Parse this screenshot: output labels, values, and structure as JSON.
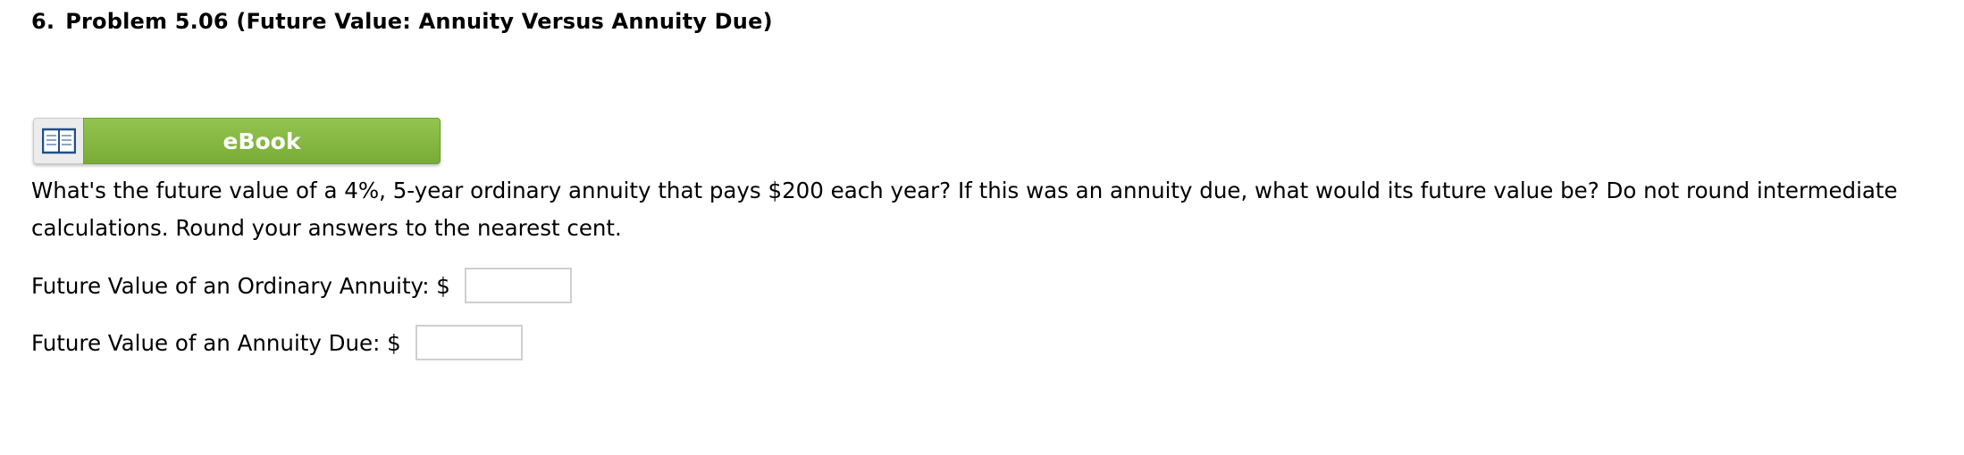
{
  "problem": {
    "number": "6.",
    "title": "Problem 5.06 (Future Value: Annuity Versus Annuity Due)"
  },
  "ebook": {
    "icon": "book-icon",
    "label": "eBook"
  },
  "question": {
    "text": "What's the future value of a 4%, 5-year ordinary annuity that pays $200 each year? If this was an annuity due, what would its future value be? Do not round intermediate calculations. Round your answers to the nearest cent."
  },
  "answers": {
    "ordinary": {
      "label": "Future Value of an Ordinary Annuity: $",
      "value": ""
    },
    "due": {
      "label": "Future Value of an Annuity Due: $",
      "value": ""
    }
  },
  "colors": {
    "ebook_green": "#86b843",
    "input_border": "#cfcfcf"
  }
}
